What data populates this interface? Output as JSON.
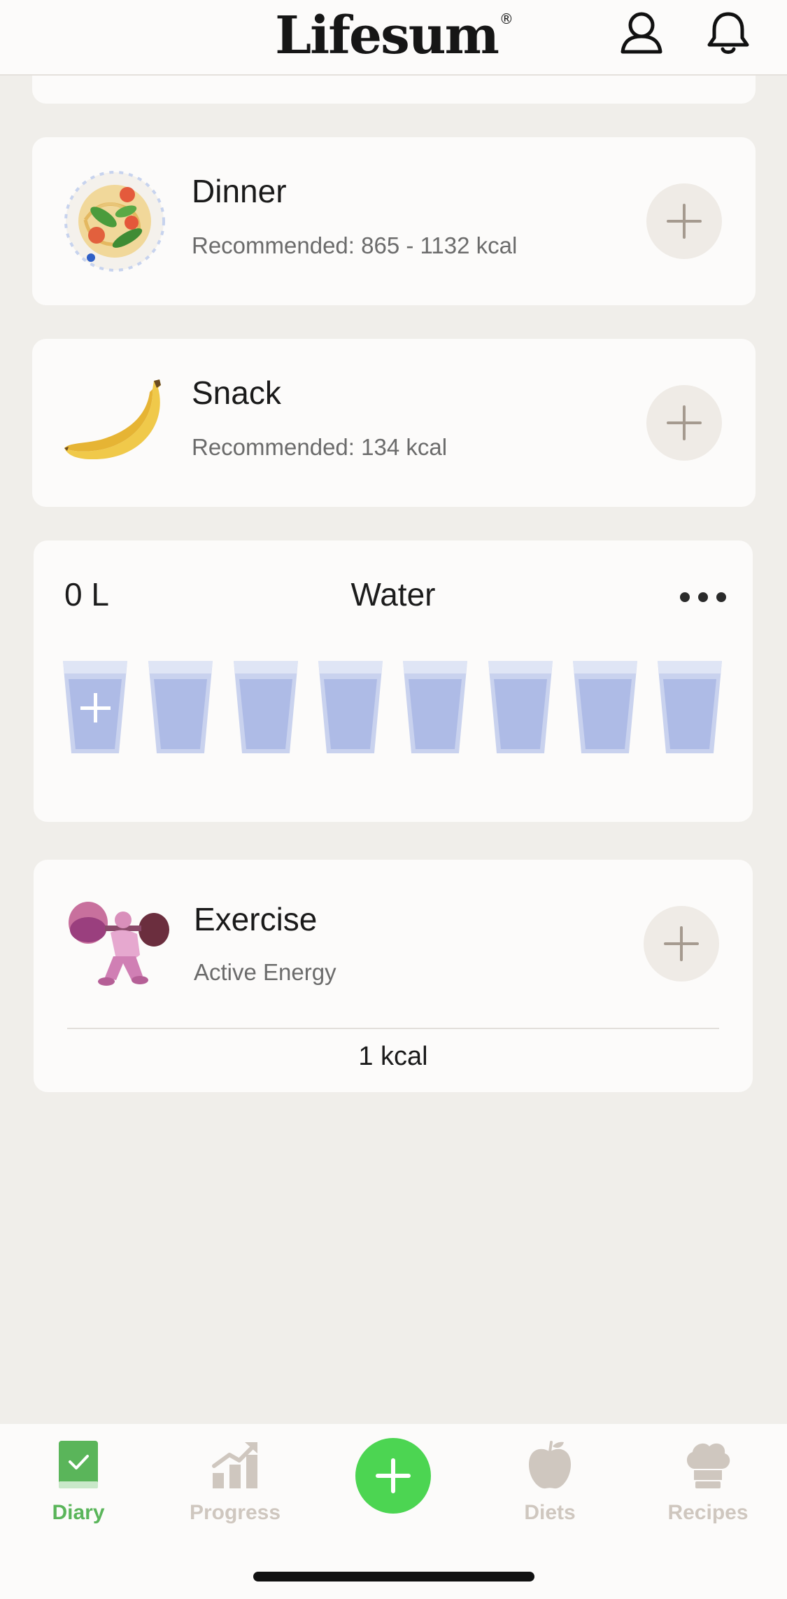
{
  "header": {
    "logo_text": "Lifesum",
    "logo_mark": "®"
  },
  "meals": [
    {
      "id": "dinner",
      "title": "Dinner",
      "recommended": "Recommended: 865 - 1132  kcal",
      "icon": "pasta-plate-icon"
    },
    {
      "id": "snack",
      "title": "Snack",
      "recommended": "Recommended: 134  kcal",
      "icon": "banana-icon"
    }
  ],
  "water": {
    "amount": "0 L",
    "title": "Water",
    "glass_count": 8
  },
  "exercise": {
    "title": "Exercise",
    "subtitle": "Active Energy",
    "kcal": "1 kcal",
    "icon": "weightlifter-icon"
  },
  "nav": {
    "items": [
      {
        "label": "Diary",
        "icon": "diary-book-icon",
        "active": true
      },
      {
        "label": "Progress",
        "icon": "progress-chart-icon",
        "active": false
      },
      {
        "label": "Diets",
        "icon": "apple-icon",
        "active": false
      },
      {
        "label": "Recipes",
        "icon": "chef-hat-icon",
        "active": false
      }
    ]
  },
  "colors": {
    "accent_green": "#4cd552",
    "active_label": "#5ab55a",
    "inactive": "#cfc7bf",
    "background": "#f0eeea"
  }
}
